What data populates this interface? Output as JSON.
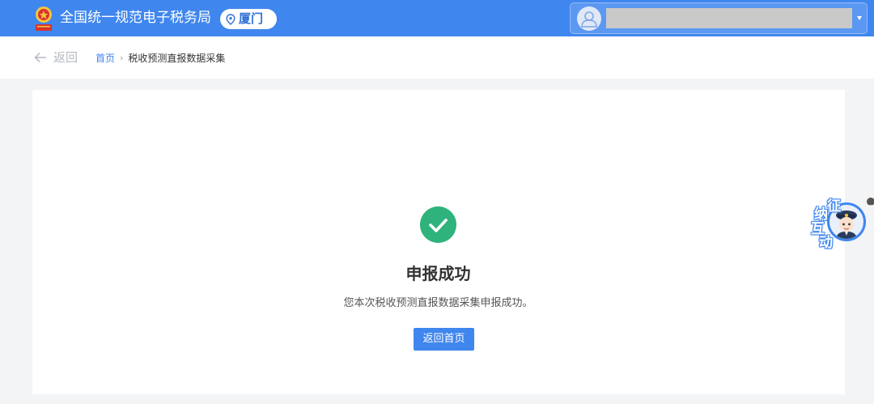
{
  "header": {
    "site_title": "全国统一规范电子税务局",
    "city": "厦门",
    "user_menu_icon": "avatar-icon",
    "colors": {
      "brand": "#3f86ee",
      "success": "#2db37b"
    }
  },
  "subbar": {
    "back_label": "返回",
    "breadcrumb": {
      "home": "首页",
      "separator": "›",
      "current": "税收预测直报数据采集"
    }
  },
  "result": {
    "icon": "check-circle-icon",
    "title": "申报成功",
    "description": "您本次税收预测直报数据采集申报成功。",
    "button_label": "返回首页"
  },
  "assistant": {
    "chars": [
      "征",
      "纳",
      "互",
      "动"
    ],
    "icon": "tax-officer-avatar"
  }
}
